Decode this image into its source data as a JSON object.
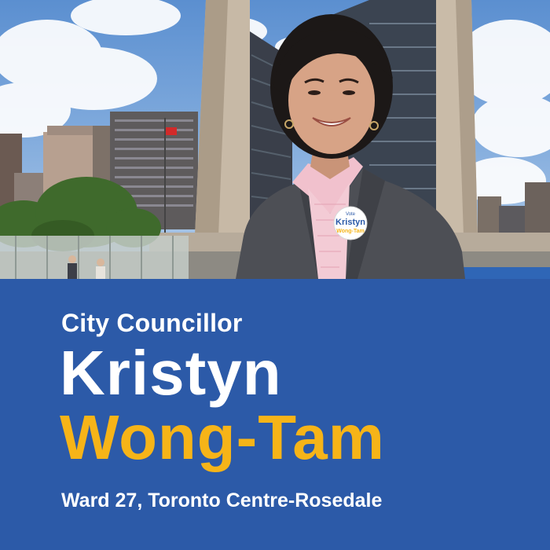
{
  "poster": {
    "title": "City Councillor",
    "first_name": "Kristyn",
    "last_name": "Wong-Tam",
    "ward": "Ward 27, Toronto Centre-Rosedale"
  },
  "badge": {
    "top_text": "Vote",
    "name_line1": "Kristyn",
    "name_line2": "Wong-Tam"
  },
  "colors": {
    "panel_blue": "#2c5aa8",
    "accent_yellow": "#f6b418",
    "text_white": "#ffffff"
  }
}
